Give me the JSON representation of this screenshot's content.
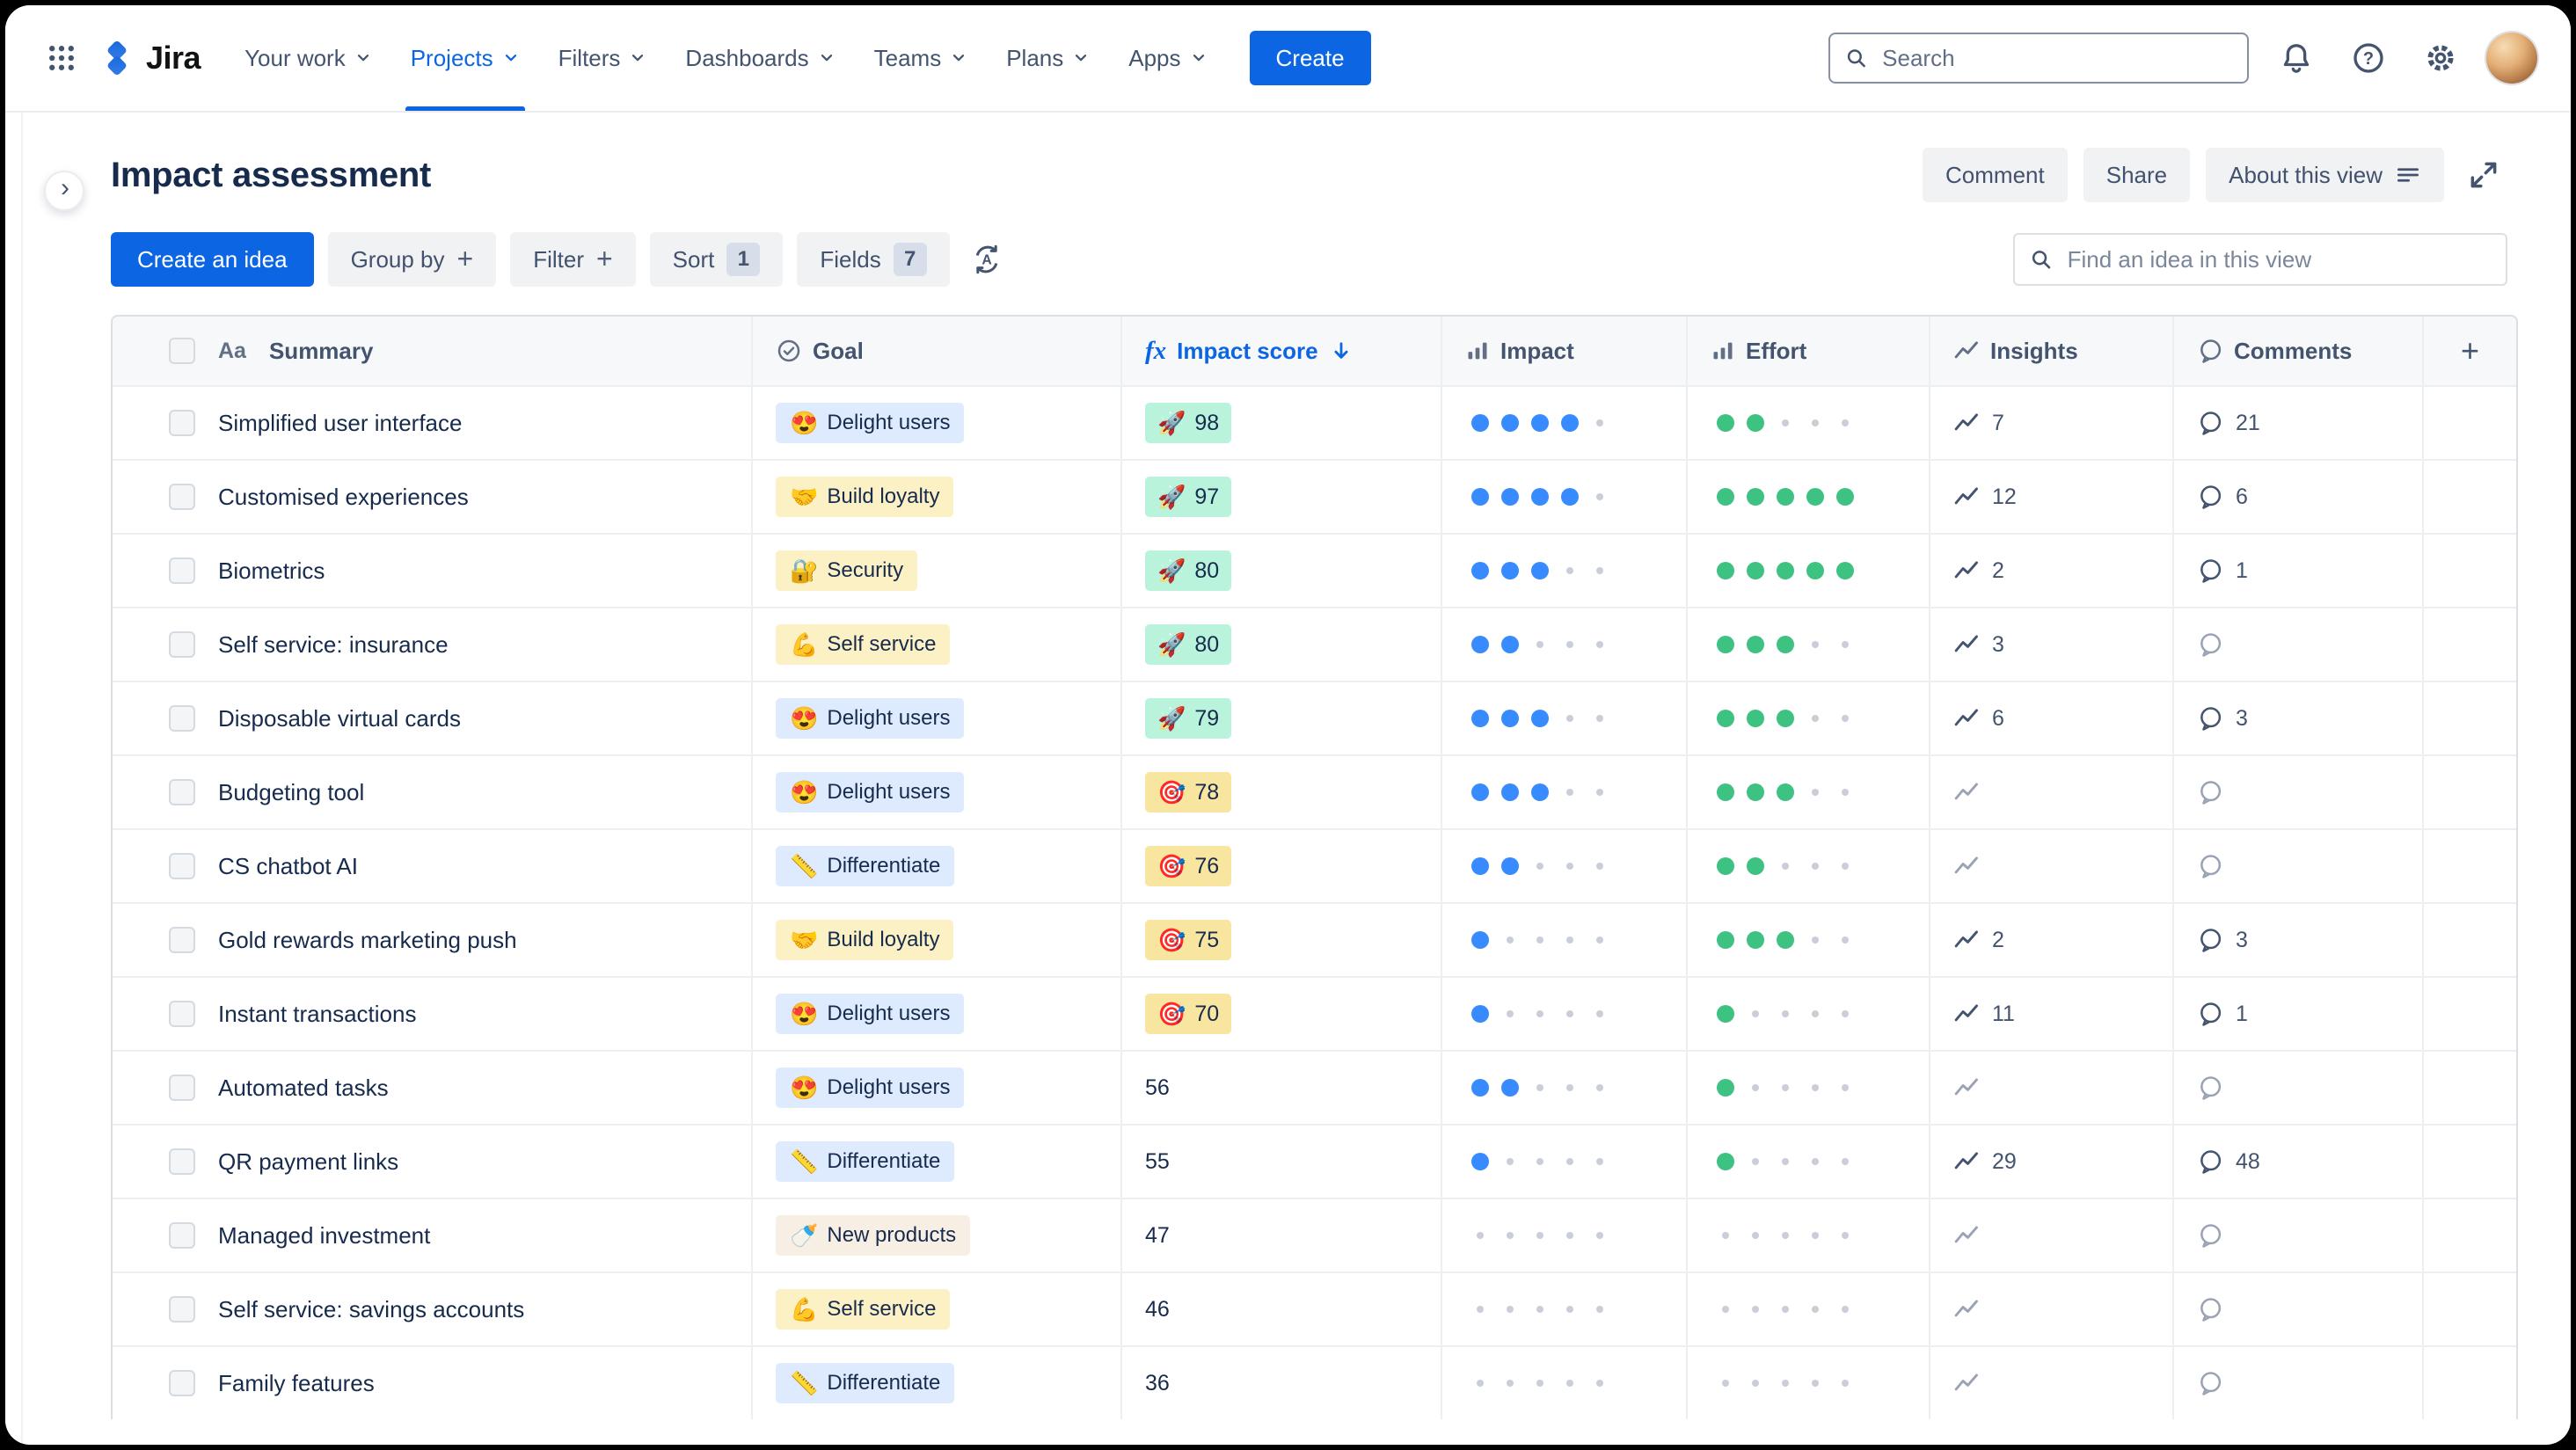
{
  "nav": {
    "logo_text": "Jira",
    "items": [
      {
        "label": "Your work"
      },
      {
        "label": "Projects",
        "active": true
      },
      {
        "label": "Filters"
      },
      {
        "label": "Dashboards"
      },
      {
        "label": "Teams"
      },
      {
        "label": "Plans"
      },
      {
        "label": "Apps"
      }
    ],
    "create_label": "Create",
    "search_placeholder": "Search"
  },
  "header": {
    "title": "Impact assessment",
    "comment_label": "Comment",
    "share_label": "Share",
    "about_label": "About this view"
  },
  "toolbar": {
    "create_idea_label": "Create an idea",
    "group_by_label": "Group by",
    "filter_label": "Filter",
    "sort_label": "Sort",
    "sort_count": "1",
    "fields_label": "Fields",
    "fields_count": "7",
    "find_placeholder": "Find an idea in this view"
  },
  "icons": {
    "help_glyph": "?",
    "auto_sort_glyph": "A",
    "plus_glyph": "+",
    "chevron_glyph": "›"
  },
  "table": {
    "columns": {
      "summary_icon": "Aa",
      "summary": "Summary",
      "goal": "Goal",
      "fx_icon": "fx",
      "impact_score": "Impact score",
      "impact": "Impact",
      "effort": "Effort",
      "insights": "Insights",
      "comments": "Comments",
      "add_column": "+"
    },
    "rows": [
      {
        "summary": "Simplified user interface",
        "goal": {
          "label": "Delight users",
          "emoji": "😍",
          "color": "blue"
        },
        "score": {
          "value": "98",
          "emoji": "🚀",
          "style": "green"
        },
        "impact": 4,
        "effort": 2,
        "insights": "7",
        "comments": "21"
      },
      {
        "summary": "Customised experiences",
        "goal": {
          "label": "Build loyalty",
          "emoji": "🤝",
          "color": "yellow"
        },
        "score": {
          "value": "97",
          "emoji": "🚀",
          "style": "green"
        },
        "impact": 4,
        "effort": 5,
        "insights": "12",
        "comments": "6"
      },
      {
        "summary": "Biometrics",
        "goal": {
          "label": "Security",
          "emoji": "🔐",
          "color": "yellow"
        },
        "score": {
          "value": "80",
          "emoji": "🚀",
          "style": "green"
        },
        "impact": 3,
        "effort": 5,
        "insights": "2",
        "comments": "1"
      },
      {
        "summary": "Self service: insurance",
        "goal": {
          "label": "Self service",
          "emoji": "💪",
          "color": "yellow"
        },
        "score": {
          "value": "80",
          "emoji": "🚀",
          "style": "green"
        },
        "impact": 2,
        "effort": 3,
        "insights": "3",
        "comments": null
      },
      {
        "summary": "Disposable virtual cards",
        "goal": {
          "label": "Delight users",
          "emoji": "😍",
          "color": "blue"
        },
        "score": {
          "value": "79",
          "emoji": "🚀",
          "style": "green"
        },
        "impact": 3,
        "effort": 3,
        "insights": "6",
        "comments": "3"
      },
      {
        "summary": "Budgeting tool",
        "goal": {
          "label": "Delight users",
          "emoji": "😍",
          "color": "blue"
        },
        "score": {
          "value": "78",
          "emoji": "🎯",
          "style": "yellow"
        },
        "impact": 3,
        "effort": 3,
        "insights": null,
        "comments": null
      },
      {
        "summary": "CS chatbot AI",
        "goal": {
          "label": "Differentiate",
          "emoji": "📏",
          "color": "blue"
        },
        "score": {
          "value": "76",
          "emoji": "🎯",
          "style": "yellow"
        },
        "impact": 2,
        "effort": 2,
        "insights": null,
        "comments": null
      },
      {
        "summary": "Gold rewards marketing push",
        "goal": {
          "label": "Build loyalty",
          "emoji": "🤝",
          "color": "yellow"
        },
        "score": {
          "value": "75",
          "emoji": "🎯",
          "style": "yellow"
        },
        "impact": 1,
        "effort": 3,
        "insights": "2",
        "comments": "3"
      },
      {
        "summary": "Instant transactions",
        "goal": {
          "label": "Delight users",
          "emoji": "😍",
          "color": "blue"
        },
        "score": {
          "value": "70",
          "emoji": "🎯",
          "style": "yellow"
        },
        "impact": 1,
        "effort": 1,
        "insights": "11",
        "comments": "1"
      },
      {
        "summary": "Automated tasks",
        "goal": {
          "label": "Delight users",
          "emoji": "😍",
          "color": "blue"
        },
        "score": {
          "value": "56",
          "emoji": null,
          "style": "plain"
        },
        "impact": 2,
        "effort": 1,
        "insights": null,
        "comments": null
      },
      {
        "summary": "QR payment links",
        "goal": {
          "label": "Differentiate",
          "emoji": "📏",
          "color": "blue"
        },
        "score": {
          "value": "55",
          "emoji": null,
          "style": "plain"
        },
        "impact": 1,
        "effort": 1,
        "insights": "29",
        "comments": "48"
      },
      {
        "summary": "Managed investment",
        "goal": {
          "label": "New products",
          "emoji": "🍼",
          "color": "cream"
        },
        "score": {
          "value": "47",
          "emoji": null,
          "style": "plain"
        },
        "impact": 0,
        "effort": 0,
        "insights": null,
        "comments": null
      },
      {
        "summary": "Self service: savings accounts",
        "goal": {
          "label": "Self service",
          "emoji": "💪",
          "color": "yellow"
        },
        "score": {
          "value": "46",
          "emoji": null,
          "style": "plain"
        },
        "impact": 0,
        "effort": 0,
        "insights": null,
        "comments": null
      },
      {
        "summary": "Family features",
        "goal": {
          "label": "Differentiate",
          "emoji": "📏",
          "color": "blue"
        },
        "score": {
          "value": "36",
          "emoji": null,
          "style": "plain"
        },
        "impact": 0,
        "effort": 0,
        "insights": null,
        "comments": null
      }
    ]
  },
  "colors": {
    "accent_blue": "#0C66E4",
    "nav_text": "#44546F",
    "title_text": "#172B4D",
    "table_header_bg": "#F7F8F9",
    "border": "#DCDFE4",
    "row_border": "#EDEEF2",
    "goal_chip_blue": "#DEEBFF",
    "goal_chip_yellow": "#FCF0C5",
    "goal_chip_cream": "#F8EFE4",
    "score_green": "#BAF3DB",
    "score_yellow": "#F8E6A0",
    "impact_dot": "#388BFF",
    "effort_dot": "#3DC282",
    "dot_empty": "#C9CED8"
  }
}
